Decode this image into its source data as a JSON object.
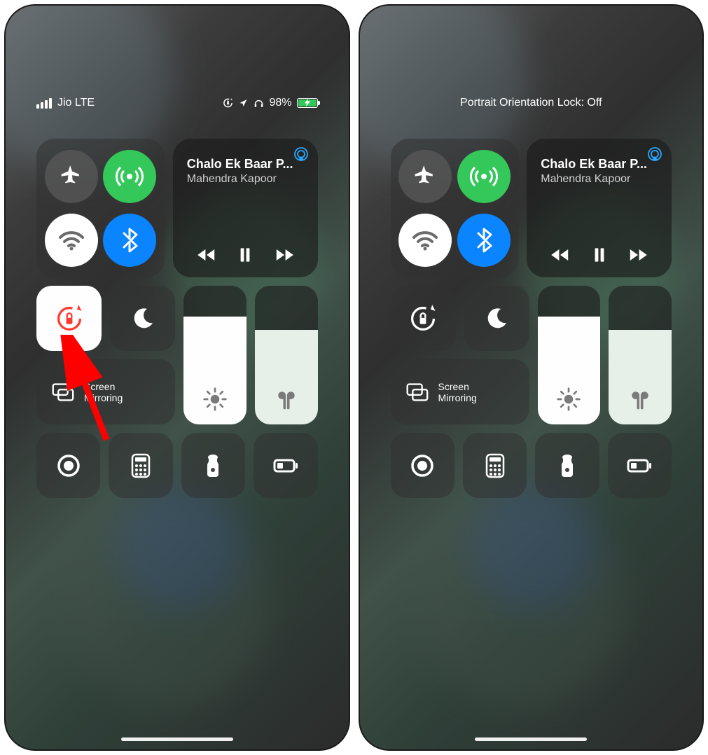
{
  "left": {
    "status": {
      "carrier": "Jio LTE",
      "battery_pct": "98%"
    },
    "media": {
      "title": "Chalo Ek Baar P...",
      "artist": "Mahendra Kapoor"
    },
    "screen_mirroring": {
      "line1": "Screen",
      "line2": "Mirroring"
    },
    "orientation_lock_active": true,
    "sliders": {
      "brightness_pct": 78,
      "volume_pct": 68
    }
  },
  "right": {
    "status": {
      "banner": "Portrait Orientation Lock: Off"
    },
    "media": {
      "title": "Chalo Ek Baar P...",
      "artist": "Mahendra Kapoor"
    },
    "screen_mirroring": {
      "line1": "Screen",
      "line2": "Mirroring"
    },
    "orientation_lock_active": false,
    "sliders": {
      "brightness_pct": 78,
      "volume_pct": 68
    }
  },
  "icons": {
    "airplane": "airplane-icon",
    "cellular": "antenna-icon",
    "wifi": "wifi-icon",
    "bluetooth": "bluetooth-icon",
    "orientation_lock": "orientation-lock-icon",
    "do_not_disturb": "moon-icon",
    "screen_mirroring": "screen-mirroring-icon",
    "brightness": "sun-icon",
    "airpods": "airpods-icon",
    "screen_record": "screen-record-icon",
    "calculator": "calculator-icon",
    "flashlight": "flashlight-icon",
    "low_power": "battery-icon",
    "location": "location-arrow-icon",
    "headphones": "headphones-icon",
    "rewind": "rewind-icon",
    "play_pause": "pause-icon",
    "forward": "forward-icon",
    "airplay_audio": "airplay-audio-icon"
  }
}
